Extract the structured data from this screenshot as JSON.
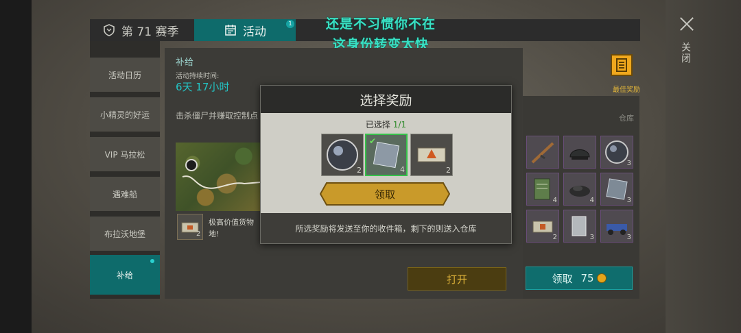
{
  "tabs": {
    "season_label": "第 71 赛季",
    "activity_label": "活动",
    "activity_badge": "1"
  },
  "overlay": {
    "line1": "还是不习惯你不在",
    "line2": "这身份转变太快"
  },
  "close": {
    "label": "关闭"
  },
  "sidebar": {
    "items": [
      {
        "label": "活动日历"
      },
      {
        "label": "小精灵的好运"
      },
      {
        "label": "VIP 马拉松"
      },
      {
        "label": "遇难船"
      },
      {
        "label": "布拉沃地堡"
      },
      {
        "label": "补给"
      }
    ]
  },
  "activity": {
    "title": "补给",
    "duration_label": "活动持续时间:",
    "duration_value": "6天 17小时",
    "description": "击杀僵尸并赚取控制点",
    "reward_count": "2",
    "reward_text": "极高价值货物 地!",
    "open_button": "打开"
  },
  "best_reward": {
    "label": "最佳奖励"
  },
  "warehouse": {
    "label": "仓库",
    "items": [
      {
        "icon": "rifle-icon",
        "count": ""
      },
      {
        "icon": "helmet-icon",
        "count": ""
      },
      {
        "icon": "lens-icon",
        "count": "3"
      },
      {
        "icon": "notebook-icon",
        "count": "4"
      },
      {
        "icon": "gravel-icon",
        "count": "4"
      },
      {
        "icon": "metal-plate-icon",
        "count": "3"
      },
      {
        "icon": "crate-icon",
        "count": "2"
      },
      {
        "icon": "sheet-icon",
        "count": "3"
      },
      {
        "icon": "vehicle-icon",
        "count": "3"
      }
    ],
    "claim_label": "领取",
    "claim_cost": "75"
  },
  "modal": {
    "title": "选择奖励",
    "selected_prefix": "已选择",
    "selected_count": "1/1",
    "rewards": [
      {
        "icon": "lens-icon",
        "count": "2",
        "chosen": false
      },
      {
        "icon": "metal-plate-icon",
        "count": "4",
        "chosen": true
      },
      {
        "icon": "warning-crate-icon",
        "count": "2",
        "chosen": false
      }
    ],
    "get_button": "领取",
    "footer": "所选奖励将发送至你的收件箱，剩下的则送入仓库"
  },
  "colors": {
    "accent_teal": "#0e6b6b",
    "gold": "#e0b43a",
    "overlay_text": "#38e0c3"
  }
}
